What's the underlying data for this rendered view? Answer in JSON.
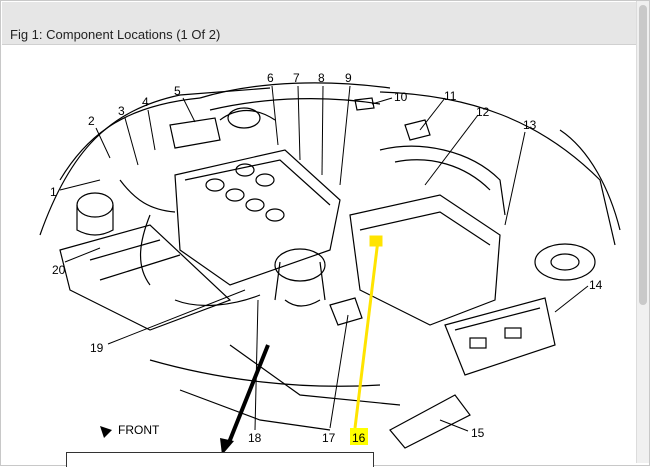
{
  "figure": {
    "title": "Fig 1: Component Locations (1 Of 2)",
    "front_label": "FRONT"
  },
  "callouts": {
    "c1": "1",
    "c2": "2",
    "c3": "3",
    "c4": "4",
    "c5": "5",
    "c6": "6",
    "c7": "7",
    "c8": "8",
    "c9": "9",
    "c10": "10",
    "c11": "11",
    "c12": "12",
    "c13": "13",
    "c14": "14",
    "c15": "15",
    "c16": "16",
    "c17": "17",
    "c18": "18",
    "c19": "19",
    "c20": "20"
  },
  "highlight": {
    "callout": "16",
    "color": "#ffff00",
    "leader_color": "#ffe400"
  },
  "colors": {
    "linework": "#000000",
    "title_bar": "#e6e6e6"
  }
}
